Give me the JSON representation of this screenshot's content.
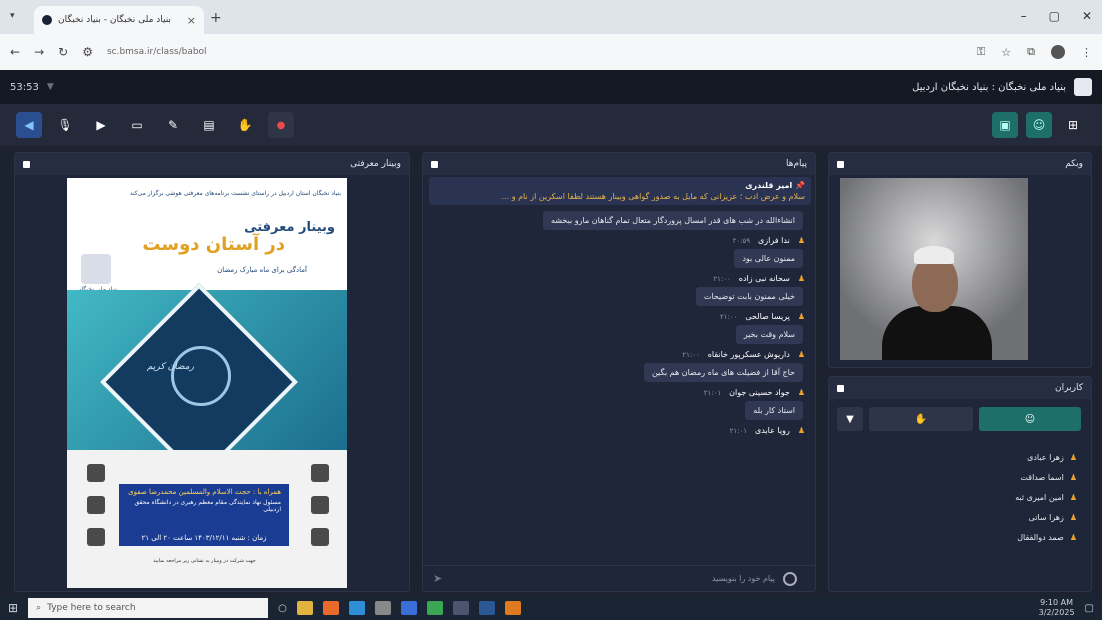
{
  "browser": {
    "tab_title": "بنیاد ملی نخبگان - بنیاد نخبگان",
    "tab_close": "×",
    "new_tab": "+",
    "url": "sc.bmsa.ir/class/babol",
    "win_min": "–",
    "win_max": "▢",
    "win_close": "✕"
  },
  "app": {
    "time": "53:53",
    "title": "بنیاد ملی نخبگان : بنیاد نخبگان اردبیل"
  },
  "panels": {
    "presentation": "وبینار معرفتی",
    "chat": "پیام‌ها",
    "webcam": "وبکم",
    "users": "کاربران"
  },
  "poster": {
    "top_text": "بنیاد نخبگان استان اردبیل در راستای نشست برنامه‌های معرفتی هوشی برگزار می‌کند",
    "title1": "وبینار معرفتی",
    "title2": "در آستان دوست",
    "subtitle": "آمادگی برای ماه مبارک رمضان",
    "logo_label": "بنیاد ملی نخبگان",
    "moon_text": "رمضان کریم",
    "speaker_line1": "همراه با : حجت الاسلام والمسلمین محمدرضا صفوی",
    "speaker_line2": "مسئول نهاد نمایندگی مقام معظم رهبری در دانشگاه محقق اردبیلی",
    "date_line": "زمان : شنبه ۱۴۰۳/۱۲/۱۱ ساعت ۲۰ الی ۲۱",
    "footer": "جهت شرکت در وبینار به نشانی زیر مراجعه نمایید"
  },
  "chat": {
    "pinned_user": "امیر قلندری",
    "pinned_text": "سلام و عرض ادب ؛ عزیزانی که مایل به صدور گواهی وبینار هستند لطفا اسکرین از نام و ...",
    "pinned_cont": "انشاءالله در شب های قدر امسال پروردگار متعال تمام گناهان مارو ببخشه",
    "messages": [
      {
        "user": "ندا فرازی",
        "time": "۲۰:۵۹",
        "text": "ممنون عالی بود"
      },
      {
        "user": "سحانه نبی زاده",
        "time": "۲۱:۰۰",
        "text": "خیلی ممنون بابت توضیحات"
      },
      {
        "user": "پریسا صالحی",
        "time": "۲۱:۰۰",
        "text": "سلام وقت بخیر"
      },
      {
        "user": "داریوش عسکرپور خانقاه",
        "time": "۲۱:۰۰",
        "text": "حاج آقا از فضیلت های ماه رمضان هم بگین"
      },
      {
        "user": "جواد حسینی جوان",
        "time": "۲۱:۰۱",
        "text": "استاد کار بله"
      },
      {
        "user": "رویا عابدی",
        "time": "۲۱:۰۱",
        "text": ""
      }
    ],
    "input_placeholder": "پیام خود را بنویسید",
    "send": "➤"
  },
  "users": {
    "list": [
      "زهرا عبادی",
      "اسما صداقت",
      "امین امیری ثبه",
      "زهرا ساتی",
      "صمد دوالفقال"
    ]
  },
  "taskbar": {
    "search_placeholder": "Type here to search",
    "time": "9:10 AM",
    "date": "3/2/2025"
  }
}
